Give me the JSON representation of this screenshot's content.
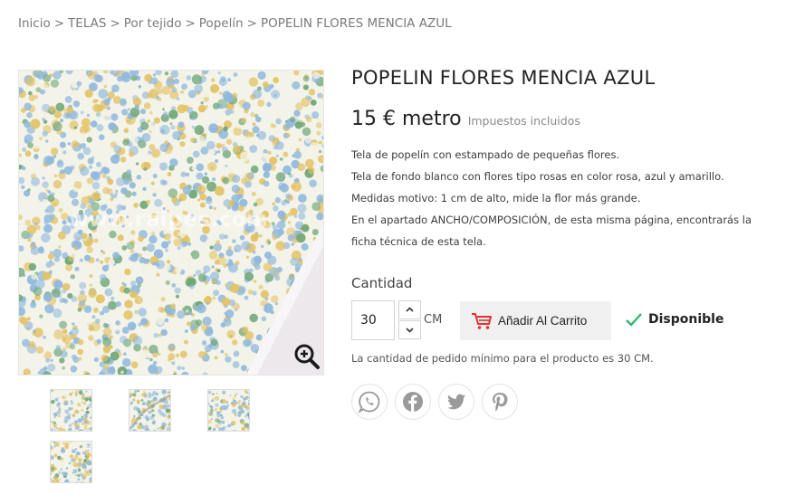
{
  "breadcrumb": {
    "items": [
      {
        "label": "Inicio"
      },
      {
        "label": "TELAS"
      },
      {
        "label": "Por tejido"
      },
      {
        "label": "Popelín"
      },
      {
        "label": "POPELIN FLORES MENCIA AZUL"
      }
    ],
    "separator": ">"
  },
  "gallery": {
    "watermark": "www.raipes.com",
    "fabric_colors": [
      "#f3f3ea",
      "#8fb8dc",
      "#e3c264",
      "#6ea678",
      "#f4f1e2"
    ],
    "thumbnails": 4
  },
  "product": {
    "title": "POPELIN FLORES MENCIA AZUL",
    "price": "15 € metro",
    "tax_note": "Impuestos incluidos",
    "description": [
      "Tela de popelín con estampado de pequeñas flores.",
      "Tela de fondo blanco con flores tipo rosas en color rosa, azul y amarillo.",
      "Medidas motivo: 1 cm de alto, mide la flor más grande.",
      "En el apartado ANCHO/COMPOSICIÓN, de esta misma página, encontrarás la",
      "ficha técnica de esta tela."
    ]
  },
  "purchase": {
    "quantity_label": "Cantidad",
    "quantity_value": "30",
    "unit": "CM",
    "add_to_cart_label": "Añadir Al Carrito",
    "availability": "Disponible",
    "min_qty_note": "La cantidad de pedido mínimo para el producto es 30 CM."
  },
  "share": {
    "icons": [
      "whatsapp-icon",
      "facebook-icon",
      "twitter-icon",
      "pinterest-icon"
    ]
  },
  "colors": {
    "accent_green": "#2fb573",
    "cart_red": "#e23030",
    "text": "#232323",
    "muted": "#7a7a7a"
  }
}
